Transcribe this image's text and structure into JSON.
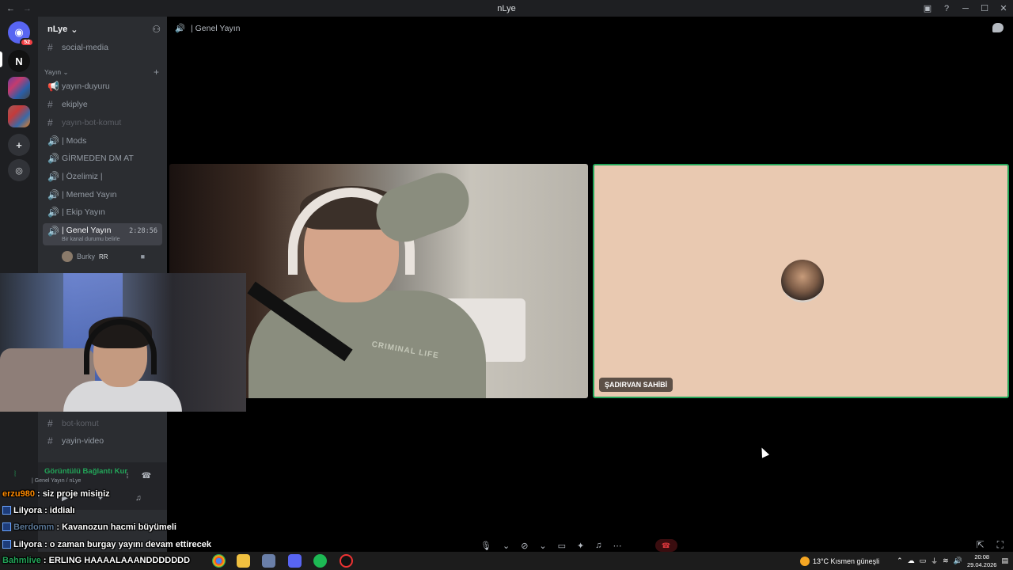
{
  "window": {
    "title": "nLye",
    "nav_back": "←",
    "nav_forward": "→"
  },
  "guild": {
    "name": "nLye"
  },
  "server_rail": {
    "home_badge": "52"
  },
  "channels": {
    "social_media": "social-media",
    "category": "Yayın",
    "yayin_duyuru": "yayın-duyuru",
    "ekiplye": "ekiplye",
    "yayin_bot_komut": "yayın-bot-komut",
    "mods": "| Mods",
    "girmeden": "GİRMEDEN DM AT",
    "ozelimiz": "| Özelimiz |",
    "memed": "| Memed Yayın",
    "ekip": "| Ekip Yayın",
    "genel": "| Genel Yayın",
    "genel_time": "2:28:56",
    "genel_status": "Bir kanal durumu belirle",
    "bot_komut": "bot-komut",
    "yayin_video": "yayin-video"
  },
  "members": [
    {
      "name": "Burky",
      "tag": "RR"
    }
  ],
  "voice_panel": {
    "status": "Görüntülü Bağlantı Kur",
    "location": "| Genel Yayın / nLye"
  },
  "main": {
    "channel_title": "| Genel Yayın",
    "shirt_text": "CRIMINAL LIFE",
    "participant_name": "ŞADIRVAN SAHİBİ"
  },
  "chat": [
    {
      "user": "erzu980",
      "text": ": siz proje misiniz",
      "color": "#ff8a00"
    },
    {
      "user": "Lilyora",
      "text": ": iddialı",
      "color": "#ffffff"
    },
    {
      "user": "Berdomm",
      "text": ": Kavanozun hacmi büyümeli",
      "color": "#ffffff"
    },
    {
      "user": "Lilyora",
      "text": ": o zaman burgay yayını devam ettirecek",
      "color": "#ffffff"
    },
    {
      "user": "Bahmlive",
      "text": ": ERLING HAAAALAAANDDDDDDD",
      "color": "#ffffff"
    }
  ],
  "taskbar": {
    "weather": "13°C  Kısmen güneşli",
    "time": "20:08",
    "date": "29.04.2026"
  },
  "colors": {
    "accent_green": "#23a559",
    "sidebar": "#2b2d31",
    "rail": "#1e1f22"
  }
}
